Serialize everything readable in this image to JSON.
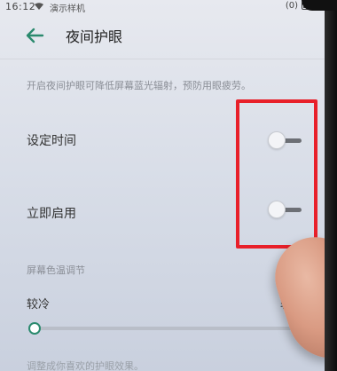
{
  "status_bar": {
    "time": "16:12",
    "carrier": "演示样机"
  },
  "header": {
    "back_icon": "arrow-left-icon",
    "title": "夜间护眼"
  },
  "description": "开启夜间护眼可降低屏幕蓝光辐射，预防用眼疲劳。",
  "settings": [
    {
      "label": "设定时间",
      "enabled": false
    },
    {
      "label": "立即启用",
      "enabled": false
    }
  ],
  "color_temp": {
    "section_label": "屏幕色温调节",
    "min_label": "较冷",
    "max_label": "较暖",
    "value_fraction": 0.0
  },
  "footer_text": "调整成你喜欢的护眼效果。",
  "colors": {
    "accent": "#2b8a6e",
    "annotation": "#e8202a"
  }
}
